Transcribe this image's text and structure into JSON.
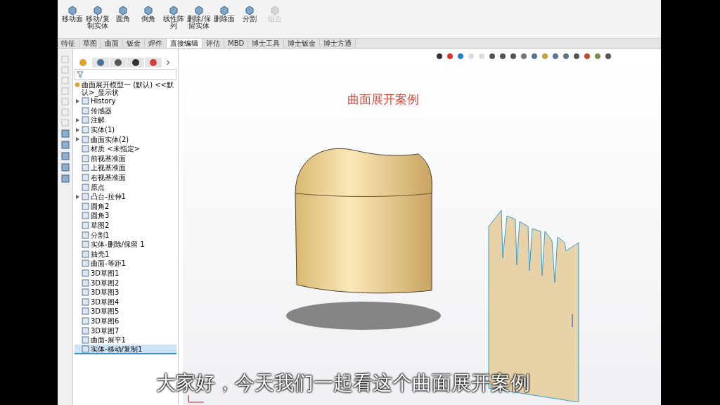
{
  "toolbar": {
    "buttons": [
      {
        "label": "移动面",
        "disabled": false
      },
      {
        "label": "移动/复制实体",
        "disabled": false
      },
      {
        "label": "圆角",
        "disabled": false
      },
      {
        "label": "倒角",
        "disabled": false
      },
      {
        "label": "线性阵列",
        "disabled": false
      },
      {
        "label": "删除/保留实体",
        "disabled": false
      },
      {
        "label": "删除面",
        "disabled": false
      },
      {
        "label": "分割",
        "disabled": false
      },
      {
        "label": "组合",
        "disabled": true
      }
    ]
  },
  "tabs": [
    {
      "label": "特征",
      "selected": false
    },
    {
      "label": "草图",
      "selected": false
    },
    {
      "label": "曲面",
      "selected": false
    },
    {
      "label": "钣金",
      "selected": false
    },
    {
      "label": "焊件",
      "selected": false
    },
    {
      "label": "直接编辑",
      "selected": true
    },
    {
      "label": "评估",
      "selected": false
    },
    {
      "label": "MBD",
      "selected": false
    },
    {
      "label": "博士工具",
      "selected": false
    },
    {
      "label": "博士钣金",
      "selected": false
    },
    {
      "label": "博士方通",
      "selected": false
    }
  ],
  "tree": {
    "root": "曲面展开模型一 (默认) <<默认>_显示状",
    "items": [
      {
        "label": "History",
        "expandable": true,
        "selected": false
      },
      {
        "label": "传感器",
        "expandable": false,
        "selected": false
      },
      {
        "label": "注解",
        "expandable": true,
        "selected": false
      },
      {
        "label": "实体(1)",
        "expandable": true,
        "selected": false
      },
      {
        "label": "曲面实体(2)",
        "expandable": true,
        "selected": false
      },
      {
        "label": "材质 <未指定>",
        "expandable": false,
        "selected": false
      },
      {
        "label": "前视基准面",
        "expandable": false,
        "selected": false
      },
      {
        "label": "上视基准面",
        "expandable": false,
        "selected": false
      },
      {
        "label": "右视基准面",
        "expandable": false,
        "selected": false
      },
      {
        "label": "原点",
        "expandable": false,
        "selected": false
      },
      {
        "label": "凸台-拉伸1",
        "expandable": true,
        "selected": false
      },
      {
        "label": "圆角2",
        "expandable": false,
        "selected": false
      },
      {
        "label": "圆角3",
        "expandable": false,
        "selected": false
      },
      {
        "label": "草图2",
        "expandable": false,
        "selected": false
      },
      {
        "label": "分割1",
        "expandable": false,
        "selected": false
      },
      {
        "label": "实体-删除/保留 1",
        "expandable": false,
        "selected": false
      },
      {
        "label": "抽壳1",
        "expandable": false,
        "selected": false
      },
      {
        "label": "曲面-等距1",
        "expandable": false,
        "selected": false
      },
      {
        "label": "3D草图1",
        "expandable": false,
        "selected": false
      },
      {
        "label": "3D草图2",
        "expandable": false,
        "selected": false
      },
      {
        "label": "3D草图3",
        "expandable": false,
        "selected": false
      },
      {
        "label": "3D草图4",
        "expandable": false,
        "selected": false
      },
      {
        "label": "3D草图5",
        "expandable": false,
        "selected": false
      },
      {
        "label": "3D草图6",
        "expandable": false,
        "selected": false
      },
      {
        "label": "3D草图7",
        "expandable": false,
        "selected": false
      },
      {
        "label": "曲面-展平1",
        "expandable": false,
        "selected": false
      },
      {
        "label": "实体-移动/复制1",
        "expandable": false,
        "selected": true
      }
    ]
  },
  "viewport": {
    "title": "曲面展开案例"
  },
  "subtitle": "大家好，今天我们一起看这个曲面展开案例"
}
